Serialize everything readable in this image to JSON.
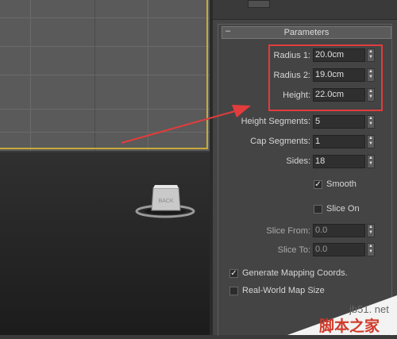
{
  "rollout": {
    "title": "Parameters",
    "collapse_symbol": "–"
  },
  "params": {
    "radius1": {
      "label": "Radius 1:",
      "value": "20.0cm"
    },
    "radius2": {
      "label": "Radius 2:",
      "value": "19.0cm"
    },
    "height": {
      "label": "Height:",
      "value": "22.0cm"
    },
    "height_segments": {
      "label": "Height Segments:",
      "value": "5"
    },
    "cap_segments": {
      "label": "Cap Segments:",
      "value": "1"
    },
    "sides": {
      "label": "Sides:",
      "value": "18"
    },
    "smooth": {
      "label": "Smooth",
      "checked": true
    },
    "slice_on": {
      "label": "Slice On",
      "checked": false
    },
    "slice_from": {
      "label": "Slice From:",
      "value": "0.0"
    },
    "slice_to": {
      "label": "Slice To:",
      "value": "0.0"
    },
    "gen_mapping": {
      "label": "Generate Mapping Coords.",
      "checked": true
    },
    "real_world": {
      "label": "Real-World Map Size",
      "checked": false
    }
  },
  "viewcube": {
    "label": "BACK"
  },
  "watermark": {
    "line1": "jb51. net",
    "line2": "脚本之家"
  },
  "colors": {
    "highlight": "#e23c3c",
    "viewport_frame": "#c6a93a",
    "arrow": "#e23c3c"
  }
}
